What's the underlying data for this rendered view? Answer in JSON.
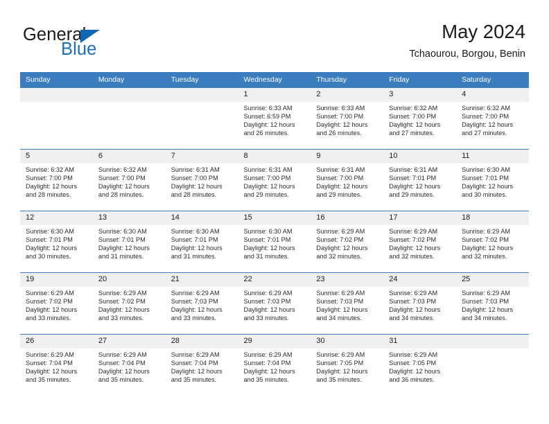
{
  "brand": {
    "line1": "General",
    "line2": "Blue",
    "logo_icon": "triangle-icon",
    "accent_color": "#1167b1"
  },
  "header": {
    "title": "May 2024",
    "subtitle": "Tchaourou, Borgou, Benin"
  },
  "theme": {
    "header_bg": "#3c7dbf",
    "daynum_bg": "#f0f0f0",
    "text": "#1a1a1a"
  },
  "weekdays": [
    "Sunday",
    "Monday",
    "Tuesday",
    "Wednesday",
    "Thursday",
    "Friday",
    "Saturday"
  ],
  "weeks": [
    [
      {
        "day": "",
        "empty": true
      },
      {
        "day": "",
        "empty": true
      },
      {
        "day": "",
        "empty": true
      },
      {
        "day": "1",
        "sunrise": "Sunrise: 6:33 AM",
        "sunset": "Sunset: 6:59 PM",
        "daylight1": "Daylight: 12 hours",
        "daylight2": "and 26 minutes."
      },
      {
        "day": "2",
        "sunrise": "Sunrise: 6:33 AM",
        "sunset": "Sunset: 7:00 PM",
        "daylight1": "Daylight: 12 hours",
        "daylight2": "and 26 minutes."
      },
      {
        "day": "3",
        "sunrise": "Sunrise: 6:32 AM",
        "sunset": "Sunset: 7:00 PM",
        "daylight1": "Daylight: 12 hours",
        "daylight2": "and 27 minutes."
      },
      {
        "day": "4",
        "sunrise": "Sunrise: 6:32 AM",
        "sunset": "Sunset: 7:00 PM",
        "daylight1": "Daylight: 12 hours",
        "daylight2": "and 27 minutes."
      }
    ],
    [
      {
        "day": "5",
        "sunrise": "Sunrise: 6:32 AM",
        "sunset": "Sunset: 7:00 PM",
        "daylight1": "Daylight: 12 hours",
        "daylight2": "and 28 minutes."
      },
      {
        "day": "6",
        "sunrise": "Sunrise: 6:32 AM",
        "sunset": "Sunset: 7:00 PM",
        "daylight1": "Daylight: 12 hours",
        "daylight2": "and 28 minutes."
      },
      {
        "day": "7",
        "sunrise": "Sunrise: 6:31 AM",
        "sunset": "Sunset: 7:00 PM",
        "daylight1": "Daylight: 12 hours",
        "daylight2": "and 28 minutes."
      },
      {
        "day": "8",
        "sunrise": "Sunrise: 6:31 AM",
        "sunset": "Sunset: 7:00 PM",
        "daylight1": "Daylight: 12 hours",
        "daylight2": "and 29 minutes."
      },
      {
        "day": "9",
        "sunrise": "Sunrise: 6:31 AM",
        "sunset": "Sunset: 7:00 PM",
        "daylight1": "Daylight: 12 hours",
        "daylight2": "and 29 minutes."
      },
      {
        "day": "10",
        "sunrise": "Sunrise: 6:31 AM",
        "sunset": "Sunset: 7:01 PM",
        "daylight1": "Daylight: 12 hours",
        "daylight2": "and 29 minutes."
      },
      {
        "day": "11",
        "sunrise": "Sunrise: 6:30 AM",
        "sunset": "Sunset: 7:01 PM",
        "daylight1": "Daylight: 12 hours",
        "daylight2": "and 30 minutes."
      }
    ],
    [
      {
        "day": "12",
        "sunrise": "Sunrise: 6:30 AM",
        "sunset": "Sunset: 7:01 PM",
        "daylight1": "Daylight: 12 hours",
        "daylight2": "and 30 minutes."
      },
      {
        "day": "13",
        "sunrise": "Sunrise: 6:30 AM",
        "sunset": "Sunset: 7:01 PM",
        "daylight1": "Daylight: 12 hours",
        "daylight2": "and 31 minutes."
      },
      {
        "day": "14",
        "sunrise": "Sunrise: 6:30 AM",
        "sunset": "Sunset: 7:01 PM",
        "daylight1": "Daylight: 12 hours",
        "daylight2": "and 31 minutes."
      },
      {
        "day": "15",
        "sunrise": "Sunrise: 6:30 AM",
        "sunset": "Sunset: 7:01 PM",
        "daylight1": "Daylight: 12 hours",
        "daylight2": "and 31 minutes."
      },
      {
        "day": "16",
        "sunrise": "Sunrise: 6:29 AM",
        "sunset": "Sunset: 7:02 PM",
        "daylight1": "Daylight: 12 hours",
        "daylight2": "and 32 minutes."
      },
      {
        "day": "17",
        "sunrise": "Sunrise: 6:29 AM",
        "sunset": "Sunset: 7:02 PM",
        "daylight1": "Daylight: 12 hours",
        "daylight2": "and 32 minutes."
      },
      {
        "day": "18",
        "sunrise": "Sunrise: 6:29 AM",
        "sunset": "Sunset: 7:02 PM",
        "daylight1": "Daylight: 12 hours",
        "daylight2": "and 32 minutes."
      }
    ],
    [
      {
        "day": "19",
        "sunrise": "Sunrise: 6:29 AM",
        "sunset": "Sunset: 7:02 PM",
        "daylight1": "Daylight: 12 hours",
        "daylight2": "and 33 minutes."
      },
      {
        "day": "20",
        "sunrise": "Sunrise: 6:29 AM",
        "sunset": "Sunset: 7:02 PM",
        "daylight1": "Daylight: 12 hours",
        "daylight2": "and 33 minutes."
      },
      {
        "day": "21",
        "sunrise": "Sunrise: 6:29 AM",
        "sunset": "Sunset: 7:03 PM",
        "daylight1": "Daylight: 12 hours",
        "daylight2": "and 33 minutes."
      },
      {
        "day": "22",
        "sunrise": "Sunrise: 6:29 AM",
        "sunset": "Sunset: 7:03 PM",
        "daylight1": "Daylight: 12 hours",
        "daylight2": "and 33 minutes."
      },
      {
        "day": "23",
        "sunrise": "Sunrise: 6:29 AM",
        "sunset": "Sunset: 7:03 PM",
        "daylight1": "Daylight: 12 hours",
        "daylight2": "and 34 minutes."
      },
      {
        "day": "24",
        "sunrise": "Sunrise: 6:29 AM",
        "sunset": "Sunset: 7:03 PM",
        "daylight1": "Daylight: 12 hours",
        "daylight2": "and 34 minutes."
      },
      {
        "day": "25",
        "sunrise": "Sunrise: 6:29 AM",
        "sunset": "Sunset: 7:03 PM",
        "daylight1": "Daylight: 12 hours",
        "daylight2": "and 34 minutes."
      }
    ],
    [
      {
        "day": "26",
        "sunrise": "Sunrise: 6:29 AM",
        "sunset": "Sunset: 7:04 PM",
        "daylight1": "Daylight: 12 hours",
        "daylight2": "and 35 minutes."
      },
      {
        "day": "27",
        "sunrise": "Sunrise: 6:29 AM",
        "sunset": "Sunset: 7:04 PM",
        "daylight1": "Daylight: 12 hours",
        "daylight2": "and 35 minutes."
      },
      {
        "day": "28",
        "sunrise": "Sunrise: 6:29 AM",
        "sunset": "Sunset: 7:04 PM",
        "daylight1": "Daylight: 12 hours",
        "daylight2": "and 35 minutes."
      },
      {
        "day": "29",
        "sunrise": "Sunrise: 6:29 AM",
        "sunset": "Sunset: 7:04 PM",
        "daylight1": "Daylight: 12 hours",
        "daylight2": "and 35 minutes."
      },
      {
        "day": "30",
        "sunrise": "Sunrise: 6:29 AM",
        "sunset": "Sunset: 7:05 PM",
        "daylight1": "Daylight: 12 hours",
        "daylight2": "and 35 minutes."
      },
      {
        "day": "31",
        "sunrise": "Sunrise: 6:29 AM",
        "sunset": "Sunset: 7:05 PM",
        "daylight1": "Daylight: 12 hours",
        "daylight2": "and 36 minutes."
      },
      {
        "day": "",
        "empty": true
      }
    ]
  ]
}
